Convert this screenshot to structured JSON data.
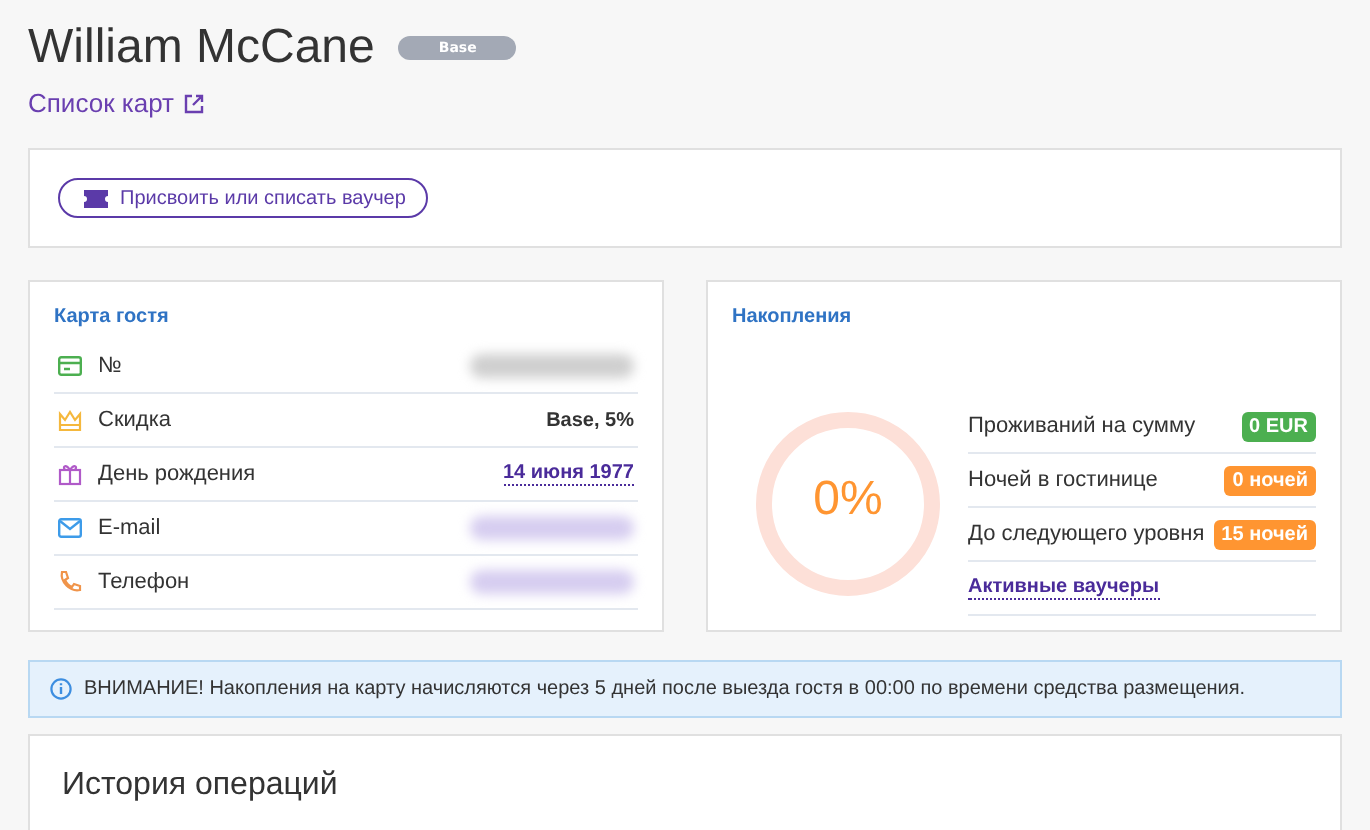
{
  "header": {
    "name": "William McCane",
    "badge": "Base",
    "link": "Список карт"
  },
  "actions": {
    "voucher_button": "Присвоить или списать ваучер"
  },
  "guest_card": {
    "title": "Карта гостя",
    "rows": [
      {
        "label": "№",
        "kind": "hidden"
      },
      {
        "label": "Скидка",
        "kind": "text",
        "value": "Base, 5%"
      },
      {
        "label": "День рождения",
        "kind": "link",
        "value": "14 июня 1977"
      },
      {
        "label": "E-mail",
        "kind": "hidden_link"
      },
      {
        "label": "Телефон",
        "kind": "hidden_link"
      }
    ]
  },
  "savings": {
    "title": "Накопления",
    "progress": {
      "level": 0,
      "reading": "0%"
    },
    "rows": [
      {
        "label": "Проживаний на сумму",
        "value": "0 EUR",
        "color": "#4caf50"
      },
      {
        "label": "Ночей в гостинице",
        "value": "0 ночей",
        "color": "#ff9531"
      },
      {
        "label": "До следующего уровня",
        "value": "15 ночей",
        "color": "#ff9531"
      }
    ],
    "vouchers_link": "Активные ваучеры"
  },
  "notice": "ВНИМАНИЕ! Накопления на карту начисляются через 5 дней после выезда гостя в 00:00 по времени средства размещения.",
  "history": {
    "title": "История операций"
  }
}
